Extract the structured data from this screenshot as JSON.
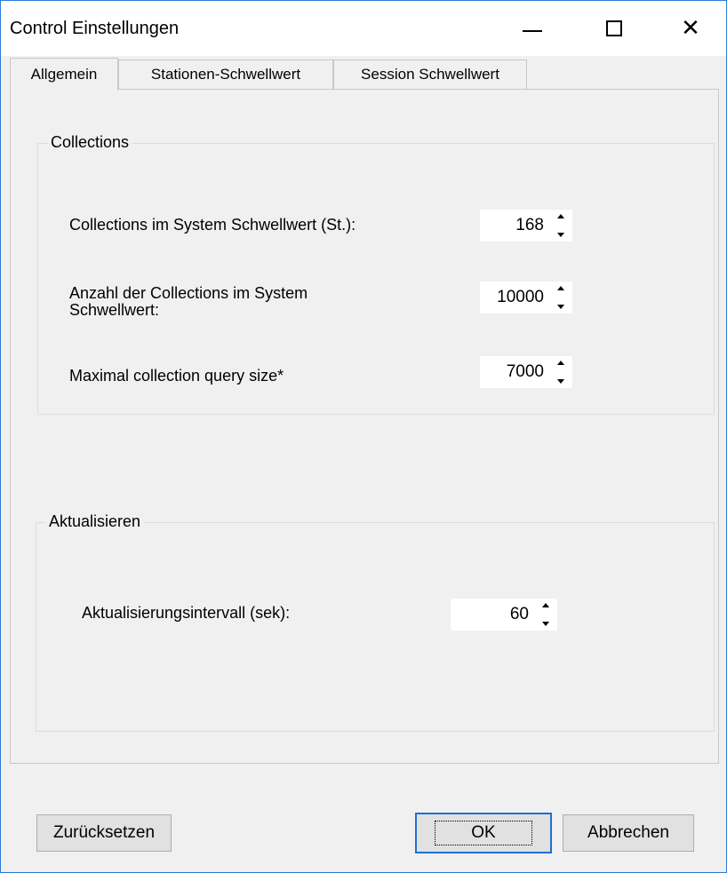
{
  "window": {
    "title": "Control Einstellungen"
  },
  "titlebar": {
    "minimize": "minimize-icon",
    "maximize": "maximize-icon",
    "close": "close-icon"
  },
  "tabs": [
    {
      "label": "Allgemein",
      "active": true
    },
    {
      "label": "Stationen-Schwellwert",
      "active": false
    },
    {
      "label": "Session Schwellwert",
      "active": false
    }
  ],
  "collections": {
    "legend": "Collections",
    "fields": [
      {
        "label": "Collections im System Schwellwert (St.):",
        "value": "168"
      },
      {
        "label": "Anzahl der Collections im System Schwellwert:",
        "label_line1": "Anzahl der Collections im System",
        "label_line2": "Schwellwert:",
        "value": "10000"
      },
      {
        "label": "Maximal collection query size*",
        "value": "7000"
      }
    ]
  },
  "aktualisieren": {
    "legend": "Aktualisieren",
    "field": {
      "label": "Aktualisierungsintervall (sek):",
      "value": "60"
    }
  },
  "buttons": {
    "reset": "Zurücksetzen",
    "ok": "OK",
    "cancel": "Abbrechen"
  }
}
